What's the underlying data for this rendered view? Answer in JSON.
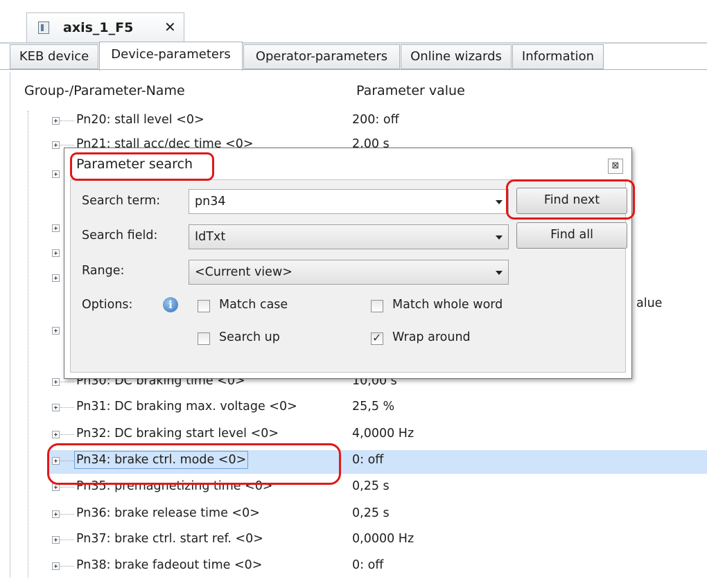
{
  "document_tab": {
    "title": "axis_1_F5",
    "close_glyph": "✕",
    "icon": "device-file-icon"
  },
  "page_tabs": [
    {
      "label": "KEB device",
      "active": false
    },
    {
      "label": "Device-parameters",
      "active": true
    },
    {
      "label": "Operator-parameters",
      "active": false
    },
    {
      "label": "Online wizards",
      "active": false
    },
    {
      "label": "Information",
      "active": false
    }
  ],
  "tree": {
    "col_name": "Group-/Parameter-Name",
    "col_value": "Parameter value",
    "rows_top": [
      {
        "name": "Pn20: stall level <0>",
        "value": "200: off"
      },
      {
        "name": "Pn21: stall acc/dec time <0>",
        "value": "2,00 s"
      }
    ],
    "partial_value": "alue",
    "rows_bottom": [
      {
        "name": "Pn30: DC braking time <0>",
        "value": "10,00 s"
      },
      {
        "name": "Pn31: DC braking max. voltage <0>",
        "value": "25,5 %"
      },
      {
        "name": "Pn32: DC braking start level <0>",
        "value": "4,0000 Hz"
      },
      {
        "name": "Pn34: brake ctrl. mode <0>",
        "value": "0: off",
        "selected": true
      },
      {
        "name": "Pn35: premagnetizing time <0>",
        "value": "0,25 s"
      },
      {
        "name": "Pn36: brake release time <0>",
        "value": "0,25 s"
      },
      {
        "name": "Pn37: brake ctrl. start ref. <0>",
        "value": "0,0000 Hz"
      },
      {
        "name": "Pn38: brake fadeout time <0>",
        "value": "0: off"
      }
    ]
  },
  "dialog": {
    "title": "Parameter search",
    "close_glyph": "⊠",
    "search_term_label": "Search term:",
    "search_term_value": "pn34",
    "search_field_label": "Search field:",
    "search_field_value": "IdTxt",
    "range_label": "Range:",
    "range_value": "<Current view>",
    "options_label": "Options:",
    "info_glyph": "i",
    "find_next": "Find next",
    "find_all": "Find all",
    "options": {
      "match_case": {
        "label": "Match case",
        "checked": false
      },
      "match_whole_word": {
        "label": "Match whole word",
        "checked": false
      },
      "search_up": {
        "label": "Search up",
        "checked": false
      },
      "wrap_around": {
        "label": "Wrap around",
        "checked": true
      }
    }
  },
  "annotation_color": "#e01818",
  "selection_color": "#cfe3fa"
}
